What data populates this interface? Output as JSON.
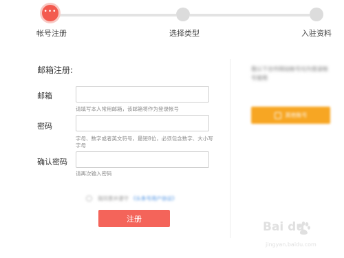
{
  "steps": [
    {
      "label": "帐号注册",
      "dots": "•••"
    },
    {
      "label": "选择类型"
    },
    {
      "label": "入驻资料"
    }
  ],
  "form": {
    "title": "邮箱注册:",
    "email": {
      "label": "邮箱",
      "value": "",
      "hint": "请填写本人常用邮箱，该邮箱将作为登录帐号"
    },
    "password": {
      "label": "密码",
      "value": "",
      "hint": "字母、数字或者英文符号，最短8位，必须包含数字、大小写字母"
    },
    "confirm": {
      "label": "确认密码",
      "value": "",
      "hint": "请再次输入密码"
    },
    "agree_text": "我同意并遵守",
    "agree_link": "《头条号用户协议》",
    "submit_label": "注册"
  },
  "right_panel": {
    "text": "我以下合作网站帐号均为登录帐号使用",
    "button_label": "其他账号"
  },
  "watermark": {
    "main": "Bai du",
    "sub": "jingyan.baidu.com"
  },
  "colors": {
    "accent": "#f35a4f",
    "submit": "#f4645a",
    "orange": "#f7a623",
    "link": "#4a90e2"
  }
}
